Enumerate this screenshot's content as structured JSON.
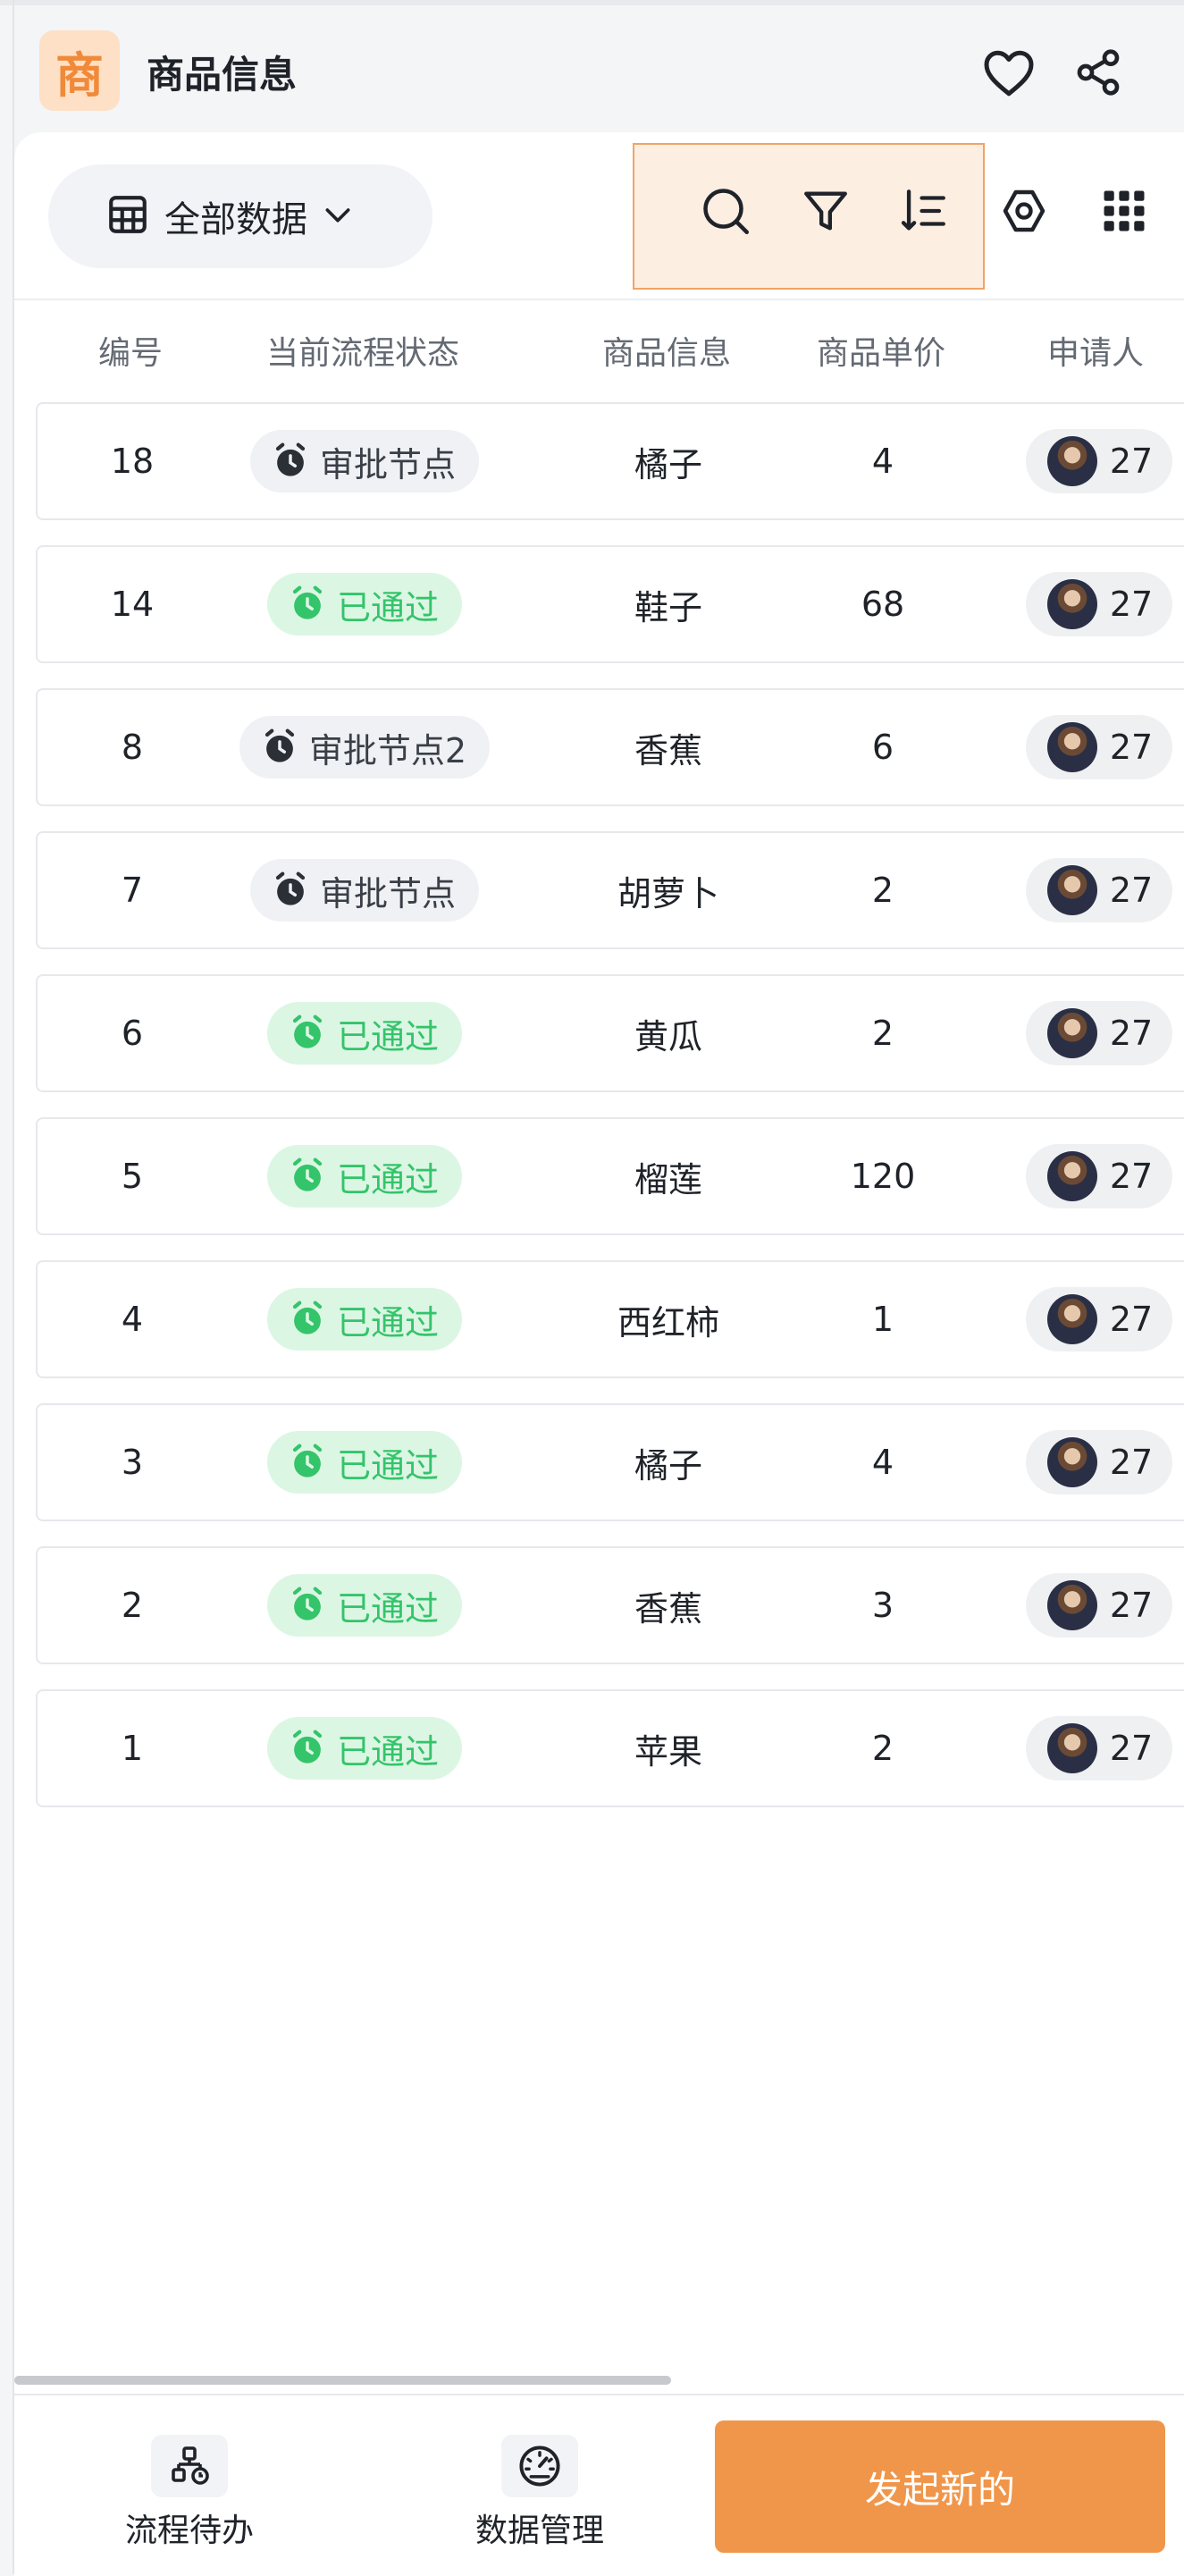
{
  "header": {
    "logo_char": "商",
    "title": "商品信息",
    "favorite_icon": "heart-icon",
    "share_icon": "share-icon"
  },
  "toolbar": {
    "view_label": "全部数据",
    "icons": [
      "table-icon",
      "chevron-down-icon",
      "search-icon",
      "filter-icon",
      "sort-icon",
      "settings-icon",
      "grid-menu-icon"
    ]
  },
  "table": {
    "columns": [
      "编号",
      "当前流程状态",
      "商品信息",
      "商品单价",
      "申请人"
    ],
    "rows": [
      {
        "id": "18",
        "status": "审批节点",
        "status_type": "pending",
        "product": "橘子",
        "price": "4",
        "applicant": "27"
      },
      {
        "id": "14",
        "status": "已通过",
        "status_type": "approved",
        "product": "鞋子",
        "price": "68",
        "applicant": "27"
      },
      {
        "id": "8",
        "status": "审批节点2",
        "status_type": "pending",
        "product": "香蕉",
        "price": "6",
        "applicant": "27"
      },
      {
        "id": "7",
        "status": "审批节点",
        "status_type": "pending",
        "product": "胡萝卜",
        "price": "2",
        "applicant": "27"
      },
      {
        "id": "6",
        "status": "已通过",
        "status_type": "approved",
        "product": "黄瓜",
        "price": "2",
        "applicant": "27"
      },
      {
        "id": "5",
        "status": "已通过",
        "status_type": "approved",
        "product": "榴莲",
        "price": "120",
        "applicant": "27"
      },
      {
        "id": "4",
        "status": "已通过",
        "status_type": "approved",
        "product": "西红柿",
        "price": "1",
        "applicant": "27"
      },
      {
        "id": "3",
        "status": "已通过",
        "status_type": "approved",
        "product": "橘子",
        "price": "4",
        "applicant": "27"
      },
      {
        "id": "2",
        "status": "已通过",
        "status_type": "approved",
        "product": "香蕉",
        "price": "3",
        "applicant": "27"
      },
      {
        "id": "1",
        "status": "已通过",
        "status_type": "approved",
        "product": "苹果",
        "price": "2",
        "applicant": "27"
      }
    ]
  },
  "bottom_nav": {
    "workflow_todo": "流程待办",
    "data_management": "数据管理",
    "new_button": "发起新的"
  },
  "colors": {
    "accent": "#f0964a",
    "approved_bg": "#dcf6e4",
    "approved_text": "#34c46a",
    "pending_bg": "#eff1f4"
  }
}
